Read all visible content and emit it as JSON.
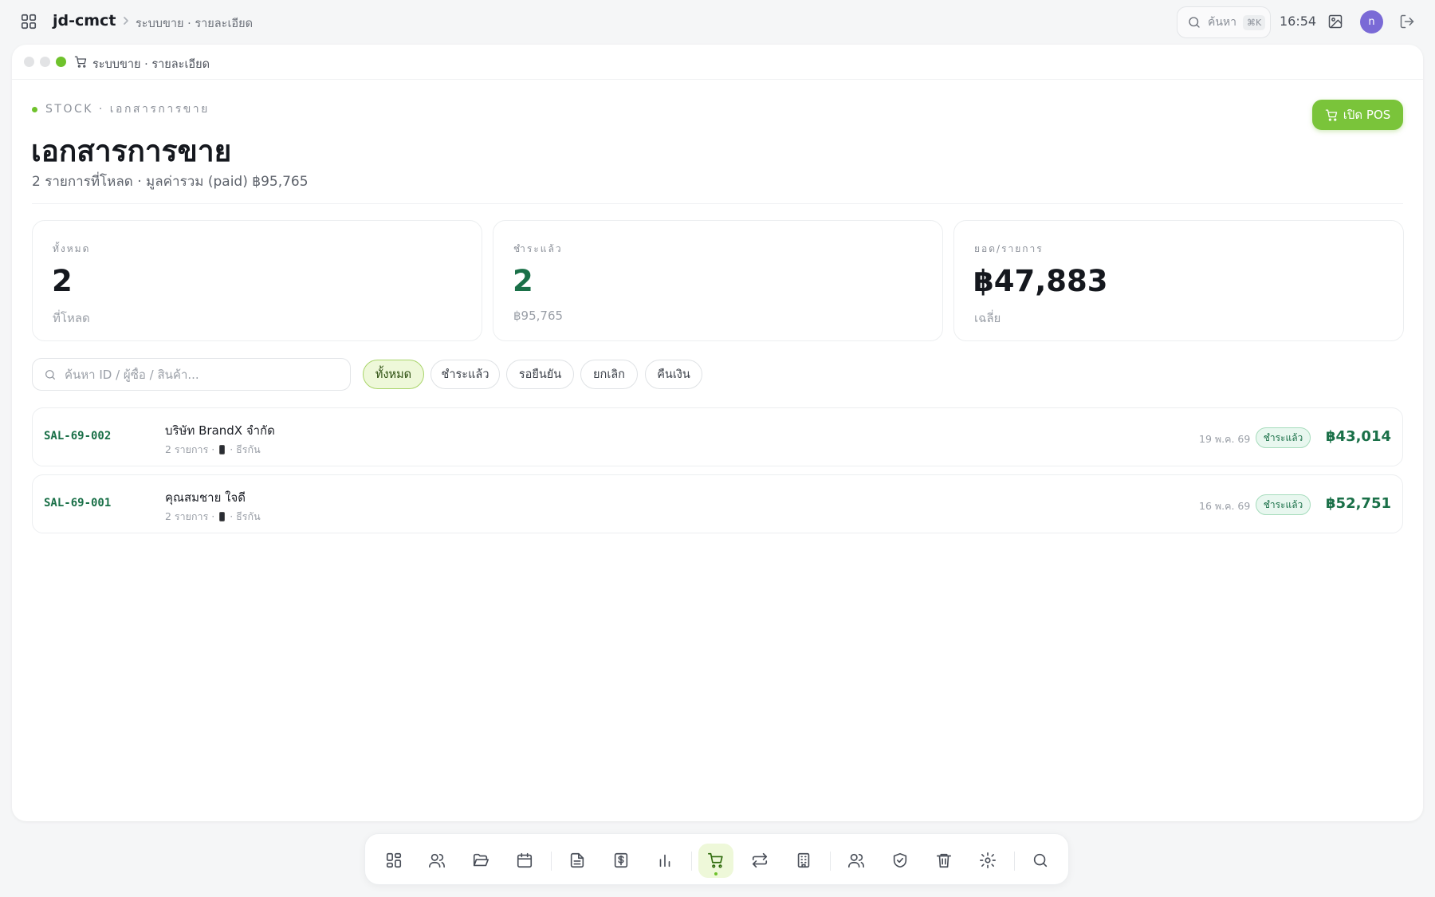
{
  "topbar": {
    "app_name": "jd-cmct",
    "breadcrumb": "ระบบขาย · รายละเอียด",
    "search_label": "ค้นหา",
    "search_shortcut": "⌘K",
    "time": "16:54",
    "avatar_initial": "n"
  },
  "window": {
    "title": "ระบบขาย · รายละเอียด",
    "dots": [
      "#e2e3e5",
      "#e2e3e5",
      "#6fc22c"
    ]
  },
  "header": {
    "eyebrow": "STOCK · เอกสารการขาย",
    "title": "เอกสารการขาย",
    "subtitle": "2 รายการที่โหลด · มูลค่ารวม (paid) ฿95,765",
    "pos_button": "เปิด POS"
  },
  "stats": [
    {
      "label": "ทั้งหมด",
      "value": "2",
      "note": "ที่โหลด",
      "color": "#15181e"
    },
    {
      "label": "ชำระแล้ว",
      "value": "2",
      "note": "฿95,765",
      "color": "#1a7048"
    },
    {
      "label": "ยอด/รายการ",
      "value": "฿47,883",
      "note": "เฉลี่ย",
      "color": "#15181e"
    }
  ],
  "filters": {
    "search_placeholder": "ค้นหา ID / ผู้ซื้อ / สินค้า...",
    "search_value": "",
    "chips": [
      "ทั้งหมด",
      "ชำระแล้ว",
      "รอยืนยัน",
      "ยกเลิก",
      "คืนเงิน"
    ],
    "active_chip": "ทั้งหมด"
  },
  "sales": [
    {
      "id": "SAL-69-002",
      "customer": "บริษัท BrandX จำกัด",
      "items": "2 รายการ ·",
      "channel": "· ธีรกัน",
      "date": "19 พ.ค. 69",
      "status": "ชำระแล้ว",
      "amount": "฿43,014"
    },
    {
      "id": "SAL-69-001",
      "customer": "คุณสมชาย ใจดี",
      "items": "2 รายการ ·",
      "channel": "· ธีรกัน",
      "date": "16 พ.ค. 69",
      "status": "ชำระแล้ว",
      "amount": "฿52,751"
    }
  ],
  "dock": {
    "icons": [
      "dashboard-icon",
      "users-icon",
      "folder-open-icon",
      "calendar-icon",
      "document-icon",
      "invoice-icon",
      "bar-chart-icon",
      "cart-icon",
      "transfer-icon",
      "building-icon",
      "team-icon",
      "shield-icon",
      "trash-icon",
      "settings-icon",
      "search-icon"
    ],
    "active": "cart-icon"
  },
  "colors": {
    "accent": "#7ac43a",
    "paid_green": "#1a7048"
  }
}
